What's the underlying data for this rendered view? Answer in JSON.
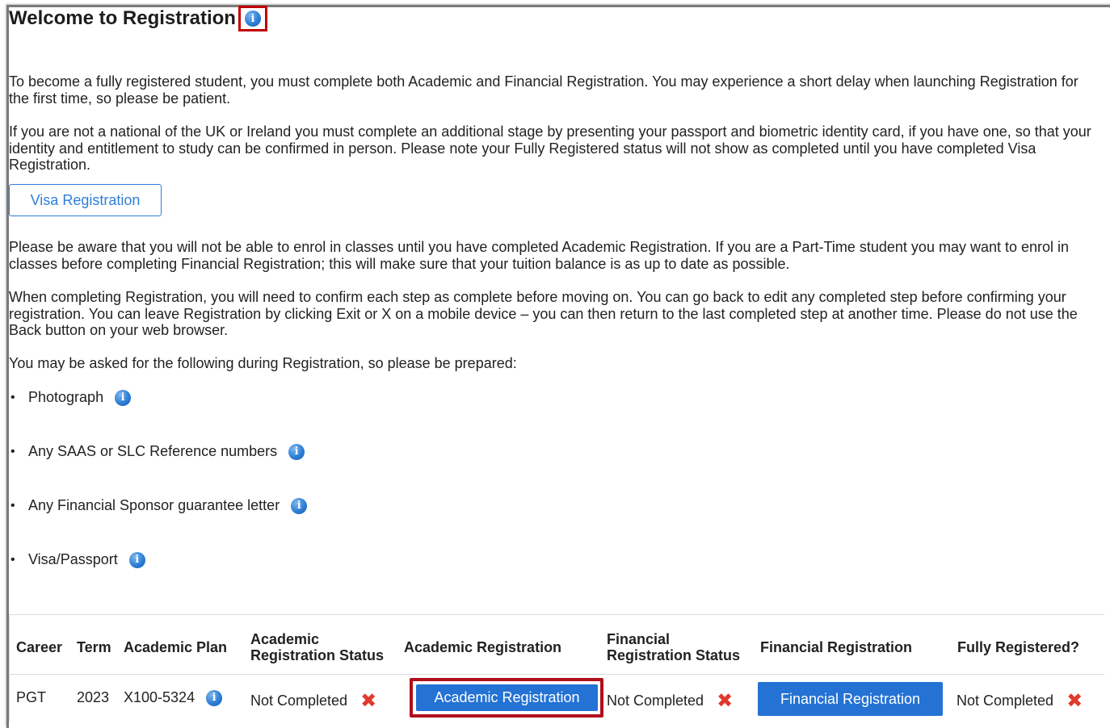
{
  "page": {
    "title": "Welcome to Registration",
    "title_info_icon": "info-icon"
  },
  "paragraphs": {
    "p1": "To become a fully registered student, you must complete both Academic and Financial Registration. You may experience a short delay when launching Registration for the first time, so please be patient.",
    "p2": "If you are not a national of the UK or Ireland you must complete an additional stage by presenting your passport and biometric identity card, if you have one, so that your identity and entitlement to study can be confirmed in person. Please note your Fully Registered status will not show as completed until you have completed Visa Registration.",
    "p3": "Please be aware that you will not be able to enrol in classes until you have completed Academic Registration. If you are a Part-Time student you may want to enrol in classes before completing Financial Registration; this will make sure that your tuition balance is as up to date as possible.",
    "p4": "When completing Registration, you will need to confirm each step as complete before moving on. You can go back to edit any completed step before confirming your registration. You can leave Registration by clicking Exit or X on a mobile device – you can then return to the last completed step at another time. Please do not use the Back button on your web browser.",
    "p5": "You may be asked for the following during Registration, so please be prepared:"
  },
  "visa_button": {
    "label": "Visa Registration"
  },
  "bullets": [
    {
      "label": "Photograph",
      "icon": "info-icon"
    },
    {
      "label": "Any SAAS or SLC Reference numbers",
      "icon": "info-icon"
    },
    {
      "label": "Any Financial Sponsor guarantee letter",
      "icon": "info-icon"
    },
    {
      "label": "Visa/Passport",
      "icon": "info-icon"
    }
  ],
  "table": {
    "headers": {
      "career": "Career",
      "term": "Term",
      "plan": "Academic Plan",
      "acad_status_1": "Academic",
      "acad_status_2": "Registration Status",
      "acad_reg": "Academic Registration",
      "fin_status_1": "Financial",
      "fin_status_2": "Registration Status",
      "fin_reg": "Financial Registration",
      "fully": "Fully Registered?"
    },
    "row": {
      "career": "PGT",
      "term": "2023",
      "plan": "X100-5324",
      "acad_status": "Not Completed",
      "acad_button": "Academic Registration",
      "fin_status": "Not Completed",
      "fin_button": "Financial Registration",
      "fully": "Not Completed",
      "status_icon": "cross-icon"
    }
  },
  "colors": {
    "accent": "#2472d4",
    "highlight": "#b00f1c",
    "cross": "#e03a2e"
  }
}
